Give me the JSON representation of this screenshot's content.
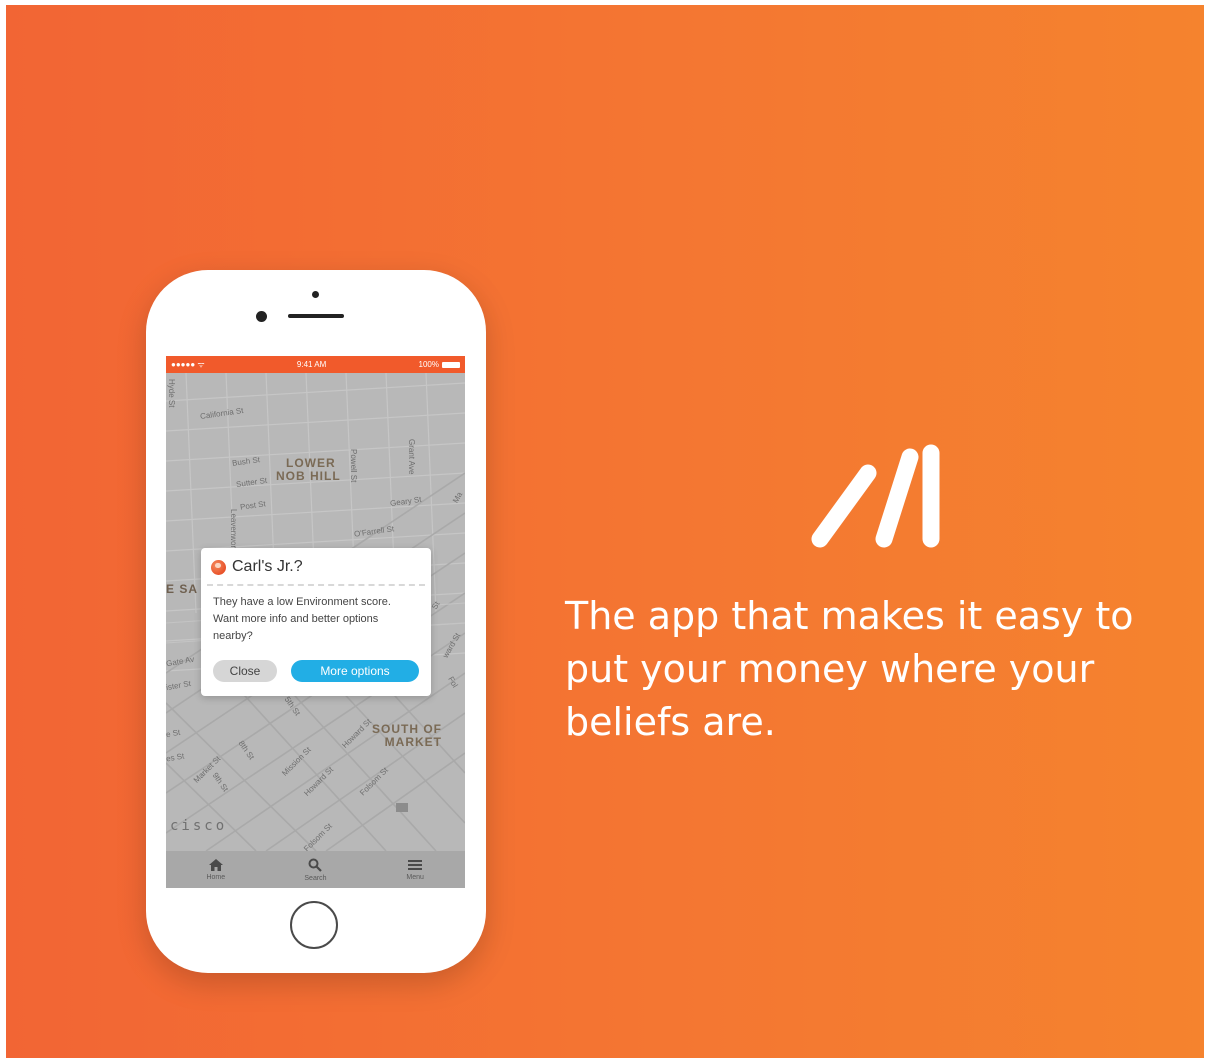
{
  "colors": {
    "background_start": "#f26534",
    "background_end": "#f5832e",
    "status_bar": "#f15a2b",
    "primary_button": "#22aee5",
    "secondary_button": "#d6d6d6"
  },
  "status_bar": {
    "signal": "●●●●● ᯤ",
    "time": "9:41 AM",
    "battery": "100%"
  },
  "map": {
    "streets": [
      "Hyde St",
      "California St",
      "Bush St",
      "Sutter St",
      "Post St",
      "Powell St",
      "Grant Ave",
      "Geary St",
      "O'Farrell St",
      "Leavenworth",
      "Gate Av",
      "ister St",
      "e St",
      "es St",
      "Market St",
      "8th St",
      "9th St",
      "Mission St",
      "Howard St",
      "Howard St",
      "Folsom St",
      "Folsom St",
      "Fol",
      "5th St",
      "St",
      "ward St",
      "Ma"
    ],
    "areas": {
      "lower_nob_hill_line1": "LOWER",
      "lower_nob_hill_line2": "NOB HILL",
      "south_of_market_line1": "SOUTH OF",
      "south_of_market_line2": "MARKET",
      "city_fragment": "cisco",
      "left_fragment": "E SA"
    }
  },
  "dialog": {
    "icon": "globe-icon",
    "title": "Carl's Jr.?",
    "body": "They have a low Environment score. Want more info and better options nearby?",
    "close_label": "Close",
    "more_label": "More options"
  },
  "tabs": [
    {
      "label": "Home",
      "icon": "home-icon"
    },
    {
      "label": "Search",
      "icon": "search-icon"
    },
    {
      "label": "Menu",
      "icon": "menu-icon"
    }
  ],
  "brand": {
    "logo": "brand-logo-icon",
    "tagline": "The app that makes it easy to put your money where your beliefs are."
  }
}
